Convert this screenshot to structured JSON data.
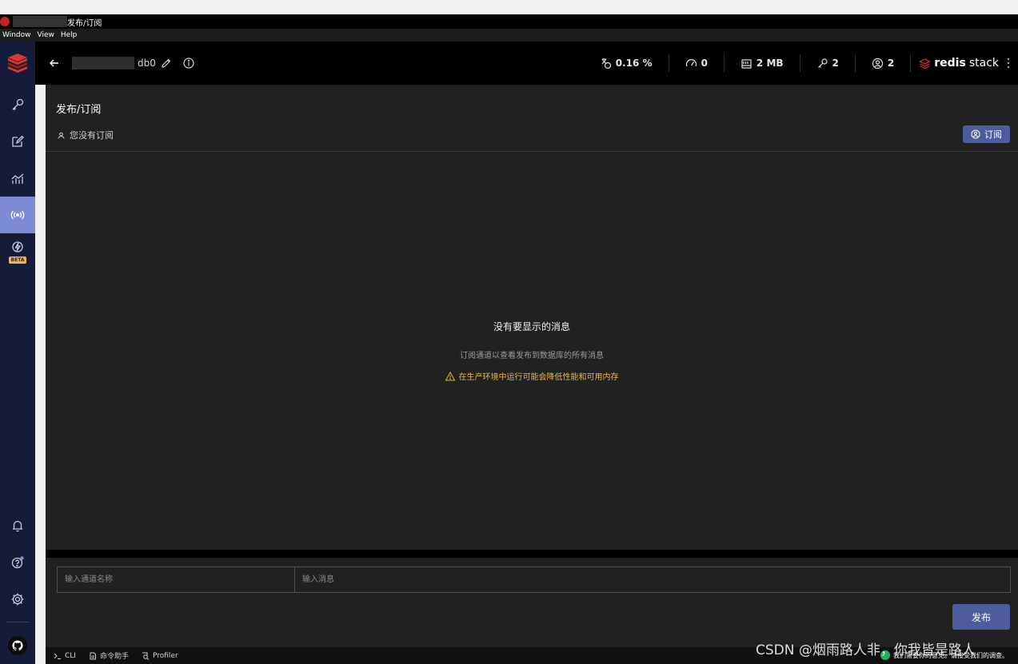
{
  "window": {
    "title": "发布/订阅",
    "menu": [
      "Window",
      "View",
      "Help"
    ]
  },
  "topbar": {
    "db_name": "db0",
    "stats": {
      "cpu": "0.16 %",
      "ops": "0",
      "memory": "2 MB",
      "keys": "2",
      "clients": "2"
    },
    "brand_bold": "redis",
    "brand_light": "stack"
  },
  "sidebar": {
    "beta_label": "BETA",
    "active_item": "pubsub"
  },
  "main": {
    "title": "发布/订阅",
    "subscription_status": "您没有订阅",
    "subscribe_label": "订阅",
    "empty_title": "没有要显示的消息",
    "empty_description": "订阅通道以查看发布到数据库的所有消息",
    "empty_warning": "在生产环境中运行可能会降低性能和可用内存"
  },
  "publish": {
    "channel_placeholder": "输入通道名称",
    "message_placeholder": "输入消息",
    "publish_label": "发布"
  },
  "footer": {
    "cli": "CLI",
    "command_helper": "命令助手",
    "profiler": "Profiler",
    "feedback": "我们需要你的意见。请接受我们的调查。"
  },
  "watermark": "CSDN @烟雨路人非，你我皆是路人",
  "colors": {
    "sidebar_bg": "#161c37",
    "active_nav": "#7b8cd4",
    "button_bg": "#4d5c9c",
    "warning": "#e8b646",
    "brand_red": "#dc382d"
  }
}
